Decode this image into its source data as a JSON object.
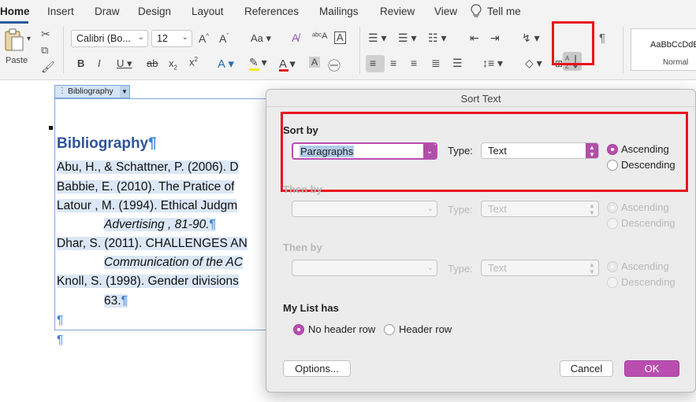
{
  "ribbon": {
    "tabs": [
      "Home",
      "Insert",
      "Draw",
      "Design",
      "Layout",
      "References",
      "Mailings",
      "Review",
      "View",
      "Tell me"
    ],
    "active_tab": "Home",
    "paste_label": "Paste",
    "font_name": "Calibri (Bo...",
    "font_size": "12",
    "styles_preview": "AaBbCcDdEe",
    "styles_name": "Normal"
  },
  "document": {
    "content_control_label": "Bibliography",
    "heading": "Bibliography",
    "pilcrow": "¶",
    "lines": [
      "Abu, H., & Schattner, P. (2006). D",
      "Babbie, E. (2010). The Pratice of",
      "Latour , M. (1994). Ethical Judgm",
      "Advertising , 81-90.",
      "Dhar, S. (2011). CHALLENGES AN",
      "Communication of the AC",
      "Knoll, S. (1998). Gender divisions",
      "63."
    ]
  },
  "dialog": {
    "title": "Sort Text",
    "sort_by_label": "Sort by",
    "sort_by_value": "Paragraphs",
    "type_label": "Type:",
    "type_value": "Text",
    "ascending": "Ascending",
    "descending": "Descending",
    "then_by_label": "Then by",
    "then_by_2_label": "Then by",
    "my_list_has_label": "My List has",
    "no_header_row": "No header row",
    "header_row": "Header row",
    "options_button": "Options...",
    "cancel_button": "Cancel",
    "ok_button": "OK"
  },
  "accent_colors": {
    "dialog_accent": "#b94eb0",
    "highlight_box": "#e8141c",
    "heading_color": "#2f5597"
  }
}
